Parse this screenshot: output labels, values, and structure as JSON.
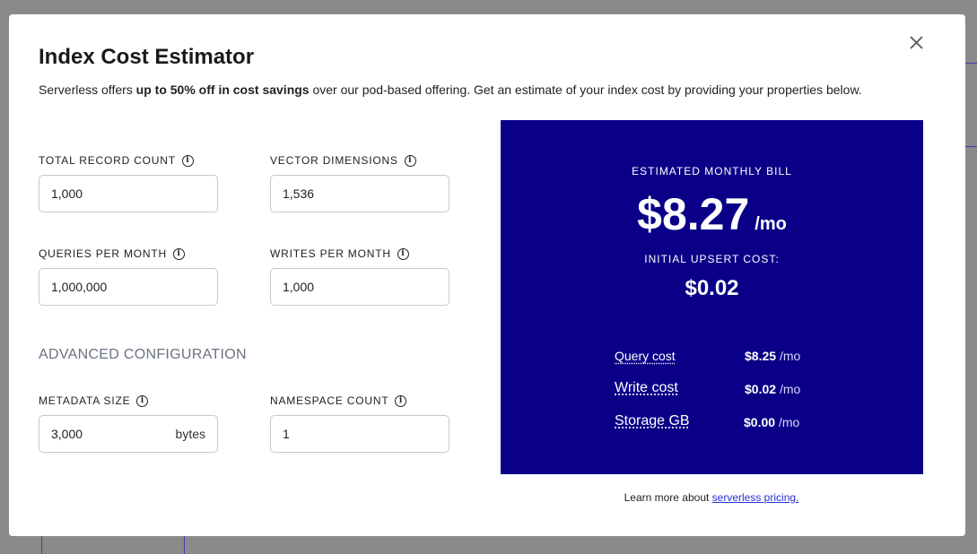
{
  "modal": {
    "title": "Index Cost Estimator",
    "subtitle_pre": "Serverless offers ",
    "subtitle_bold": "up to 50% off in cost savings",
    "subtitle_post": " over our pod-based offering. Get an estimate of your index cost by providing your properties below."
  },
  "fields": {
    "record_count": {
      "label": "TOTAL RECORD COUNT",
      "value": "1,000"
    },
    "vector_dimensions": {
      "label": "VECTOR DIMENSIONS",
      "value": "1,536"
    },
    "queries_per_month": {
      "label": "QUERIES PER MONTH",
      "value": "1,000,000"
    },
    "writes_per_month": {
      "label": "WRITES PER MONTH",
      "value": "1,000"
    },
    "metadata_size": {
      "label": "METADATA SIZE",
      "value": "3,000",
      "unit": "bytes"
    },
    "namespace_count": {
      "label": "NAMESPACE COUNT",
      "value": "1"
    }
  },
  "advanced": {
    "heading": "ADVANCED CONFIGURATION"
  },
  "estimate": {
    "caption": "ESTIMATED MONTHLY BILL",
    "amount": "$8.27",
    "per": "/mo",
    "upsert_caption": "INITIAL UPSERT COST:",
    "upsert_amount": "$0.02",
    "breakdown": [
      {
        "name": "Query cost",
        "amount": "$8.25",
        "per": "/mo"
      },
      {
        "name": "Write cost",
        "amount": "$0.02",
        "per": "/mo"
      },
      {
        "name": "Storage GB",
        "amount": "$0.00",
        "per": "/mo"
      }
    ],
    "panel_color": "#0a0087"
  },
  "footer": {
    "learn_pre": "Learn more about ",
    "learn_link": "serverless pricing."
  }
}
